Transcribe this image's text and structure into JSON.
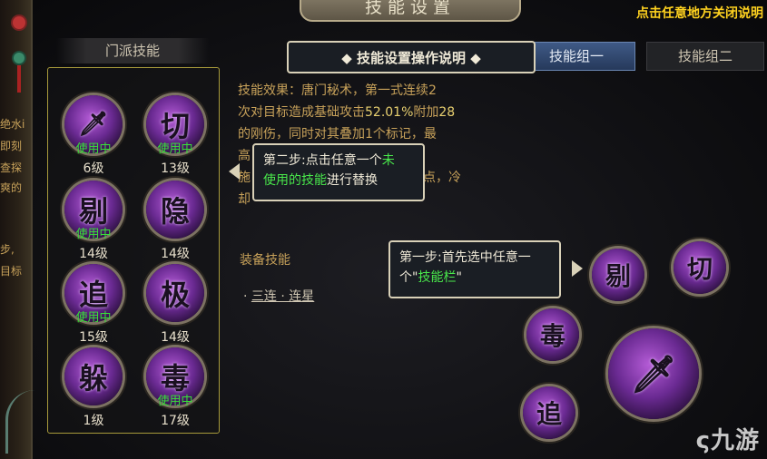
{
  "header": {
    "title": "技能设置",
    "close_hint": "点击任意地方关闭说明"
  },
  "left_strip": {
    "fragments": [
      "绝水i",
      "即刻",
      "查探",
      "爽的",
      "步,",
      "目标"
    ]
  },
  "skill_list": {
    "title": "门派技能",
    "skills": [
      {
        "glyph": "",
        "status": "使用中",
        "level": "6级"
      },
      {
        "glyph": "切",
        "status": "使用中",
        "level": "13级"
      },
      {
        "glyph": "剔",
        "status": "使用中",
        "level": "14级"
      },
      {
        "glyph": "隐",
        "status": "",
        "level": "14级"
      },
      {
        "glyph": "追",
        "status": "使用中",
        "level": "15级"
      },
      {
        "glyph": "极",
        "status": "",
        "level": "14级"
      },
      {
        "glyph": "躲",
        "status": "",
        "level": "1级"
      },
      {
        "glyph": "毒",
        "status": "使用中",
        "level": "17级"
      }
    ]
  },
  "description": {
    "line1": "技能效果：唐门秘术，第一式连续2",
    "line2a": "次对目标造成基础攻击",
    "line2b": "52.01%",
    "line2c": "附加",
    "line2d": "28",
    "line3": "的刚伤，同时对其叠加1个标记，最",
    "line4": "高",
    "line5a": "施",
    "line5b": "点，冷",
    "line6": "却"
  },
  "equip": {
    "label": "装备技能",
    "item": "三连 · 连星"
  },
  "tabs": {
    "group1": "技能组一",
    "group2": "技能组二"
  },
  "popups": {
    "title": "◆ 技能设置操作说明 ◆",
    "step2_a": "第二步:点击任意一个",
    "step2_b": "未",
    "step2_c": "使用的技能",
    "step2_d": "进行替换",
    "step1_a": "第一步:首先选中任意一",
    "step1_b": "个\"",
    "step1_c": "技能栏",
    "step1_d": "\""
  },
  "equipped_slots": [
    {
      "glyph": "剔"
    },
    {
      "glyph": "切"
    },
    {
      "glyph": "毒"
    },
    {
      "glyph": ""
    },
    {
      "glyph": "追"
    }
  ],
  "watermark": "九游",
  "colors": {
    "accent_gold": "#c8a25a",
    "in_use_green": "#38e038",
    "highlight_green": "#49e84b",
    "hint_yellow": "#ffd21f",
    "active_tab": "#3f5a86"
  }
}
